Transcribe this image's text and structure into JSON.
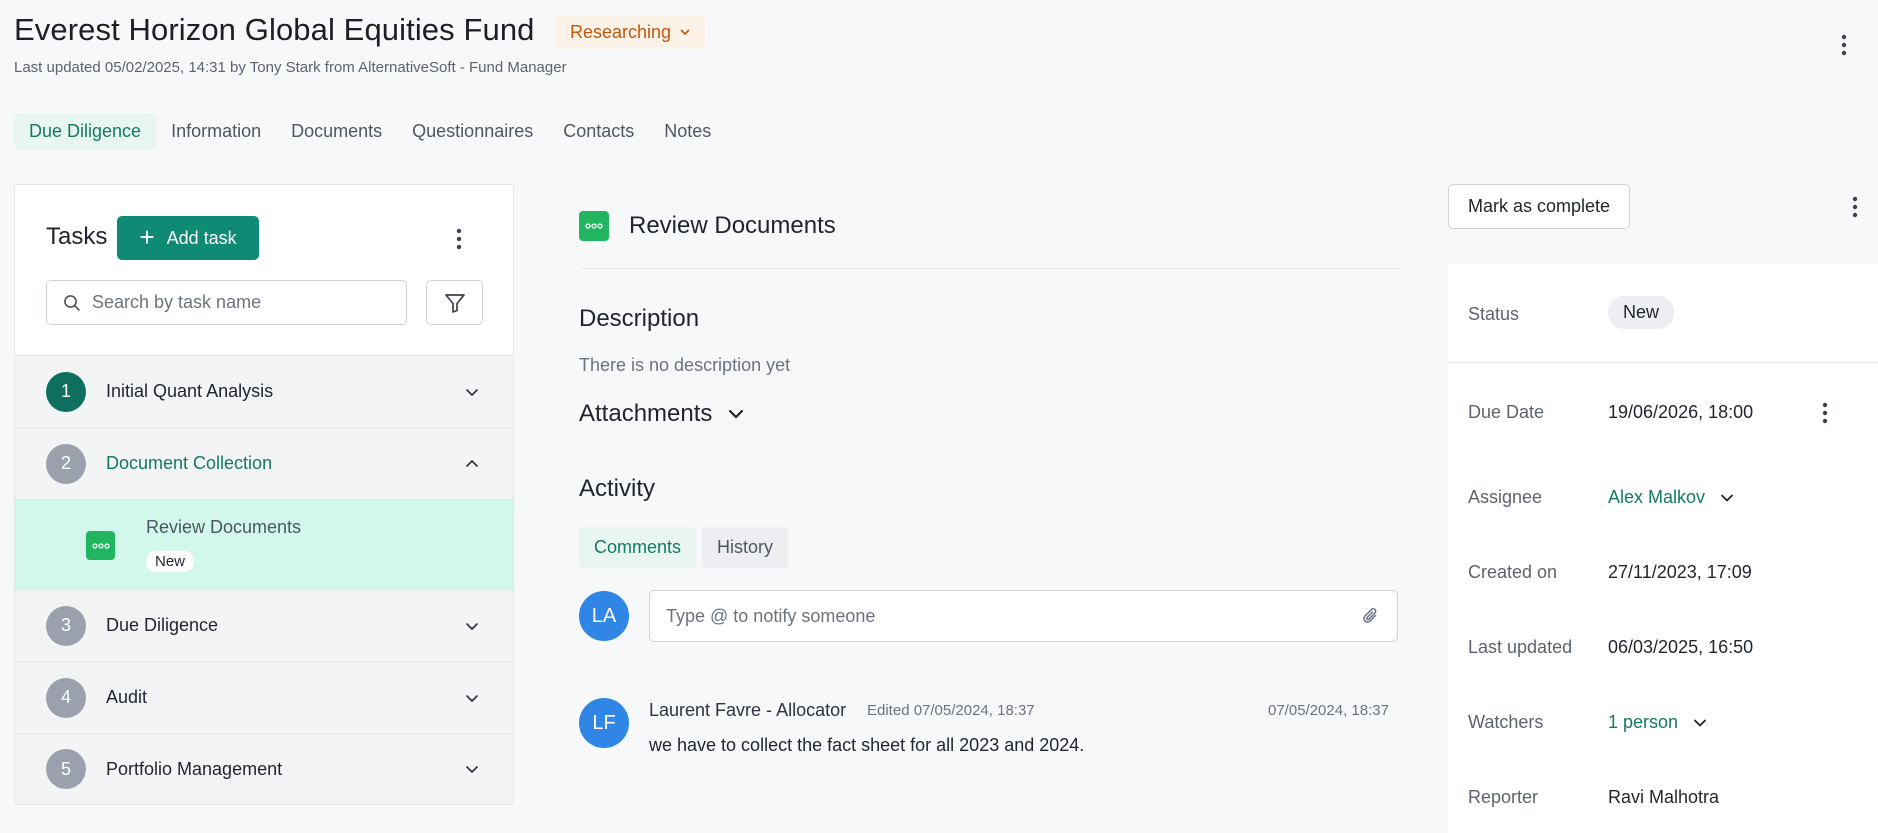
{
  "header": {
    "fund_name": "Everest Horizon Global Equities Fund",
    "status": "Researching",
    "last_updated": "Last updated 05/02/2025, 14:31 by Tony Stark from AlternativeSoft - Fund Manager"
  },
  "tabs": [
    {
      "label": "Due Diligence",
      "active": true
    },
    {
      "label": "Information"
    },
    {
      "label": "Documents"
    },
    {
      "label": "Questionnaires"
    },
    {
      "label": "Contacts"
    },
    {
      "label": "Notes"
    }
  ],
  "tasks_panel": {
    "title": "Tasks",
    "add_task_label": "Add task",
    "search_placeholder": "Search by task name",
    "groups": [
      {
        "number": "1",
        "name": "Initial Quant Analysis"
      },
      {
        "number": "2",
        "name": "Document Collection",
        "expanded": true,
        "subtasks": [
          {
            "name": "Review Documents",
            "status": "New",
            "selected": true
          }
        ]
      },
      {
        "number": "3",
        "name": "Due Diligence"
      },
      {
        "number": "4",
        "name": "Audit"
      },
      {
        "number": "5",
        "name": "Portfolio Management"
      }
    ]
  },
  "task_detail": {
    "title": "Review Documents",
    "description_heading": "Description",
    "description_text": "There is no description yet",
    "attachments_heading": "Attachments",
    "activity_heading": "Activity",
    "activity_tabs": [
      {
        "label": "Comments",
        "active": true
      },
      {
        "label": "History"
      }
    ],
    "current_user_initials": "LA",
    "comment_placeholder": "Type @ to notify someone",
    "comments": [
      {
        "initials": "LF",
        "author": "Laurent Favre - Allocator",
        "edited": "Edited 07/05/2024, 18:37",
        "date": "07/05/2024, 18:37",
        "text": "we have to collect the fact sheet for all 2023 and 2024."
      }
    ]
  },
  "details_panel": {
    "mark_complete_label": "Mark as complete",
    "status_label": "Status",
    "status_value": "New",
    "due_date_label": "Due Date",
    "due_date_value": "19/06/2026, 18:00",
    "assignee_label": "Assignee",
    "assignee_value": "Alex Malkov",
    "created_label": "Created on",
    "created_value": "27/11/2023, 17:09",
    "last_updated_label": "Last updated",
    "last_updated_value": "06/03/2025, 16:50",
    "watchers_label": "Watchers",
    "watchers_value": "1 person",
    "reporter_label": "Reporter",
    "reporter_value": "Ravi Malhotra"
  },
  "colors": {
    "accent": "#0f8a74",
    "accent_text": "#127a63",
    "status_orange": "#c2570c",
    "selected_row": "#d2f8ec",
    "task_icon_green": "#22b55f",
    "avatar_blue": "#2f86e4"
  },
  "icons": {
    "status_chevron": "chevron-down-icon",
    "add": "plus-icon",
    "search": "search-icon",
    "filter": "filter-icon",
    "more": "kebab-icon",
    "task": "task-dots-icon",
    "attach": "paperclip-icon"
  }
}
